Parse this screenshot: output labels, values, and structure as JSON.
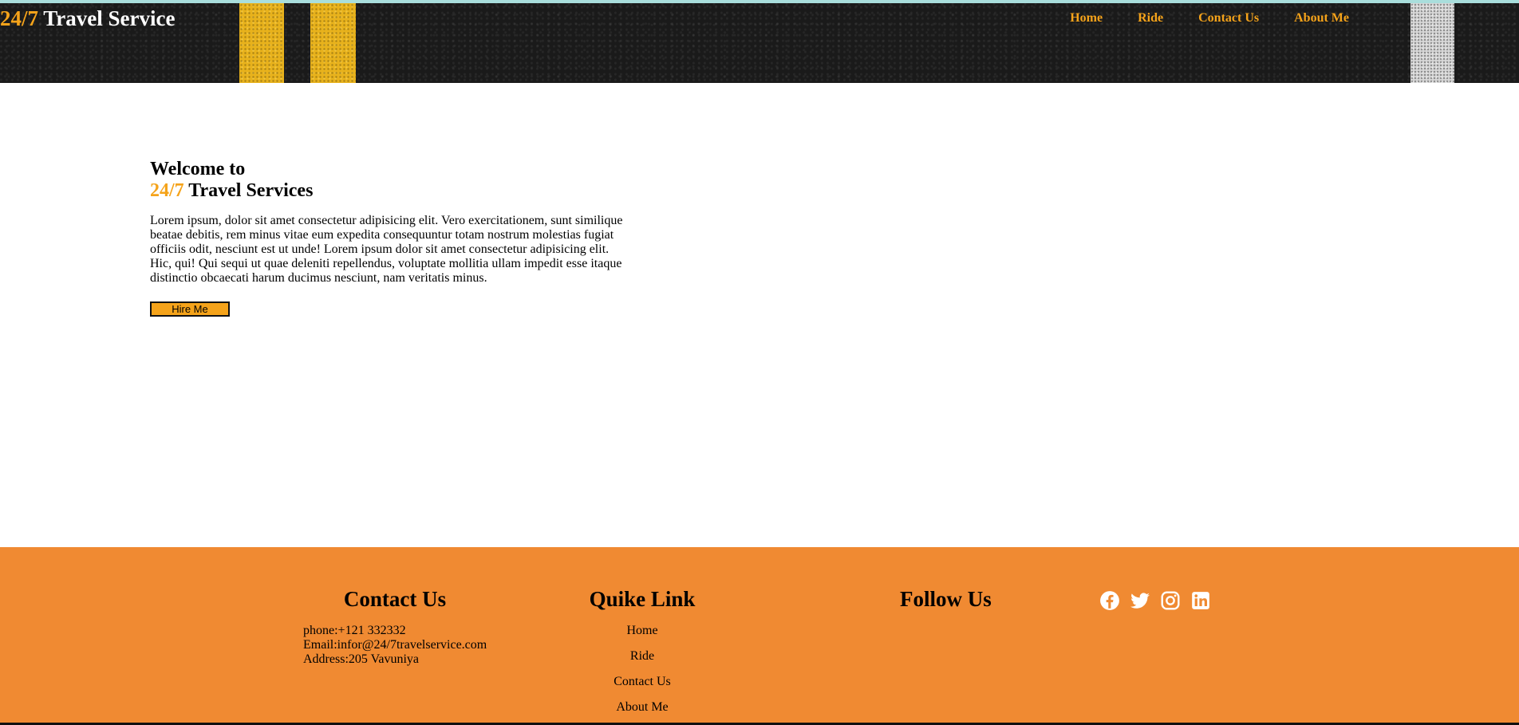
{
  "header": {
    "brand_accent": "24/7",
    "brand_rest": " Travel Service",
    "nav": [
      {
        "label": "Home"
      },
      {
        "label": "Ride"
      },
      {
        "label": "Contact Us"
      },
      {
        "label": "About Me"
      }
    ]
  },
  "hero": {
    "title_line1": "Welcome to",
    "title_accent": "24/7",
    "title_rest": " Travel Services",
    "body": "Lorem ipsum, dolor sit amet consectetur adipisicing elit. Vero exercitationem, sunt similique beatae debitis, rem minus vitae eum expedita consequuntur totam nostrum molestias fugiat officiis odit, nesciunt est ut unde! Lorem ipsum dolor sit amet consectetur adipisicing elit. Hic, qui! Qui sequi ut quae deleniti repellendus, voluptate mollitia ullam impedit esse itaque distinctio obcaecati harum ducimus nesciunt, nam veritatis minus.",
    "button_label": "Hire Me"
  },
  "footer": {
    "contact_title": "Contact Us",
    "phone": "phone:+121 332332",
    "email": "Email:infor@24/7travelservice.com",
    "address": "Address:205 Vavuniya",
    "links_title": "Quike Link",
    "links": [
      {
        "label": "Home"
      },
      {
        "label": "Ride"
      },
      {
        "label": "Contact Us"
      },
      {
        "label": "About Me"
      }
    ],
    "follow_title": "Follow Us",
    "social_icons": [
      "facebook-icon",
      "twitter-icon",
      "instagram-icon",
      "linkedin-icon"
    ]
  },
  "colors": {
    "accent": "#f5a31a",
    "footer_bg": "#f08a32",
    "header_bg": "#1a1a1a"
  }
}
